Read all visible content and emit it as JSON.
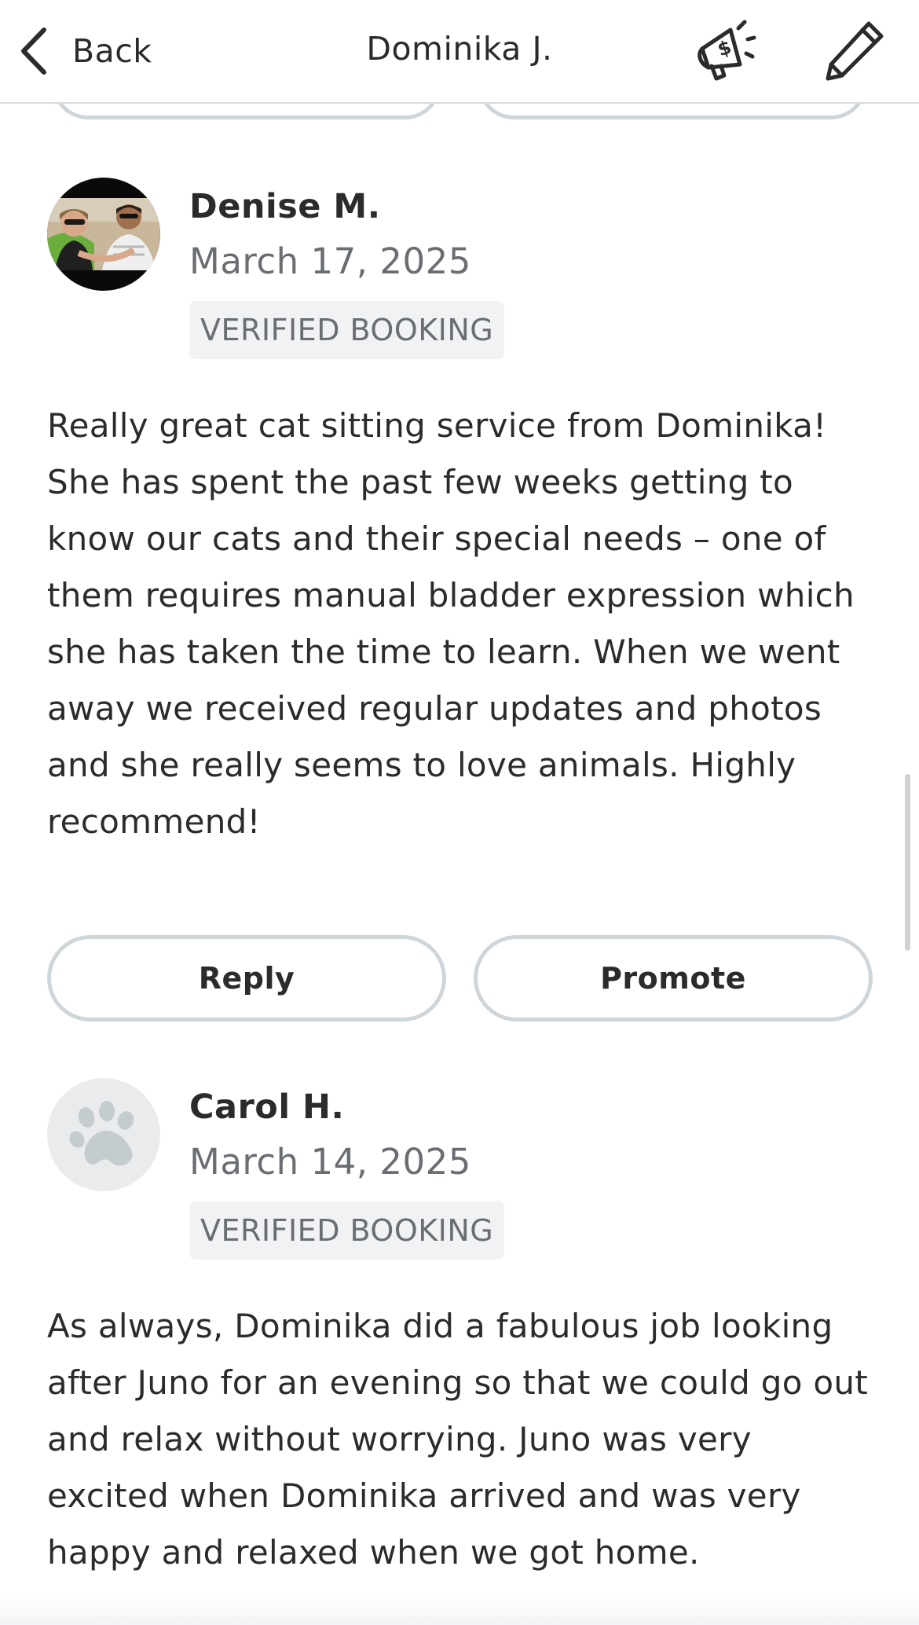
{
  "header": {
    "back_label": "Back",
    "title": "Dominika J.",
    "icons": {
      "back": "chevron-left-icon",
      "promote": "megaphone-dollar-icon",
      "edit": "pencil-icon"
    }
  },
  "reviews": [
    {
      "name": "Denise M.",
      "date": "March 17, 2025",
      "badge": "VERIFIED BOOKING",
      "avatar": "photo",
      "text": "Really great cat sitting service from Dominika! She has spent the past few weeks getting to know our cats and their special needs – one of them requires manual bladder expression which she has taken the time to learn. When we went away we received regular updates and photos and she really seems to love animals. Highly recommend!",
      "actions": {
        "reply": "Reply",
        "promote": "Promote"
      }
    },
    {
      "name": "Carol H.",
      "date": "March 14, 2025",
      "badge": "VERIFIED BOOKING",
      "avatar": "paw-placeholder",
      "text": "As always, Dominika did a fabulous job looking after Juno for an evening so that we could go out and relax without worrying. Juno was very excited when Dominika arrived and was very happy and relaxed when we got home."
    }
  ],
  "colors": {
    "text": "#2b2b2b",
    "muted": "#6a6e73",
    "border": "#cfd6da",
    "badge_bg": "#f1f2f3"
  }
}
